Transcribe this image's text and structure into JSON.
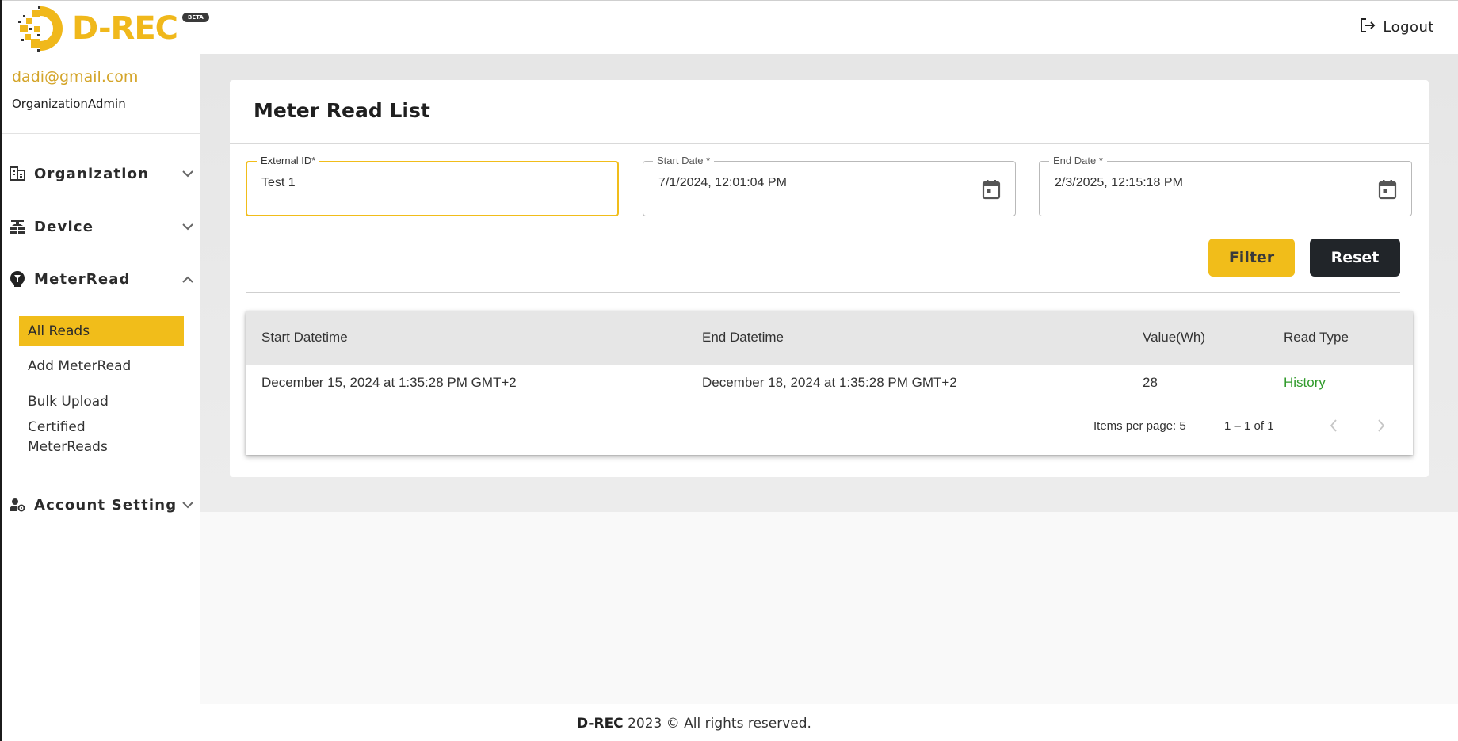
{
  "app": {
    "brand": "D-REC",
    "beta_badge": "BETA",
    "logout_label": "Logout"
  },
  "user": {
    "email": "dadi@gmail.com",
    "role": "OrganizationAdmin"
  },
  "sidebar": {
    "items": [
      {
        "label": "Organization",
        "icon": "building-icon",
        "expanded": false
      },
      {
        "label": "Device",
        "icon": "device-icon",
        "expanded": false
      },
      {
        "label": "MeterRead",
        "icon": "meter-icon",
        "expanded": true
      },
      {
        "label": "Account Setting",
        "icon": "user-gear-icon",
        "expanded": false
      }
    ],
    "meterread_subitems": [
      {
        "label": "All Reads",
        "active": true
      },
      {
        "label": "Add MeterRead",
        "active": false
      },
      {
        "label": "Bulk Upload",
        "active": false
      },
      {
        "label": "Certified MeterReads",
        "active": false
      }
    ]
  },
  "page": {
    "title": "Meter Read List",
    "filters": {
      "external_id": {
        "label": "External ID*",
        "value": "Test 1"
      },
      "start_date": {
        "label": "Start Date *",
        "value": "7/1/2024, 12:01:04 PM"
      },
      "end_date": {
        "label": "End Date *",
        "value": "2/3/2025, 12:15:18 PM"
      }
    },
    "buttons": {
      "filter": "Filter",
      "reset": "Reset"
    }
  },
  "table": {
    "columns": [
      "Start Datetime",
      "End Datetime",
      "Value(Wh)",
      "Read Type"
    ],
    "rows": [
      {
        "start": "December 15, 2024 at 1:35:28 PM GMT+2",
        "end": "December 18, 2024 at 1:35:28 PM GMT+2",
        "value": "28",
        "read_type": "History"
      }
    ],
    "paginator": {
      "items_per_page_label": "Items per page: 5",
      "range_label": "1 – 1 of 1"
    }
  },
  "footer": {
    "brand": "D-REC",
    "text": " 2023 © All rights reserved."
  },
  "colors": {
    "accent": "#f1bd1a",
    "dark": "#212529",
    "success": "#2f9a2a"
  }
}
